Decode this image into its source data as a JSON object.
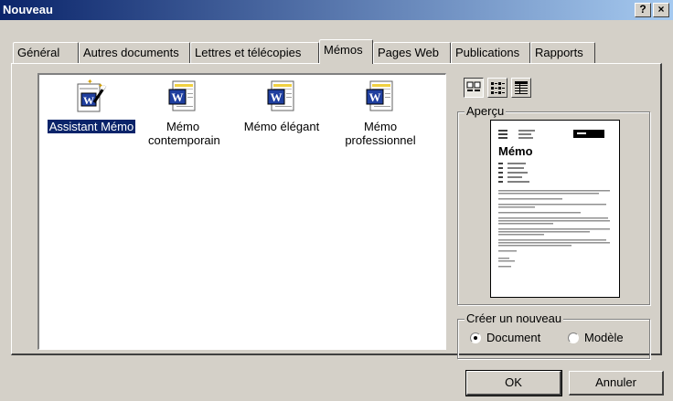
{
  "window": {
    "title": "Nouveau",
    "help_label": "?",
    "close_label": "×"
  },
  "tabs": [
    {
      "label": "Général",
      "active": false
    },
    {
      "label": "Autres documents",
      "active": false
    },
    {
      "label": "Lettres et télécopies",
      "active": false
    },
    {
      "label": "Mémos",
      "active": true
    },
    {
      "label": "Pages Web",
      "active": false
    },
    {
      "label": "Publications",
      "active": false
    },
    {
      "label": "Rapports",
      "active": false
    }
  ],
  "templates": [
    {
      "label": "Assistant Mémo",
      "icon": "word-wizard-icon",
      "selected": true
    },
    {
      "label": "Mémo contemporain",
      "icon": "word-document-icon",
      "selected": false
    },
    {
      "label": "Mémo élégant",
      "icon": "word-document-icon",
      "selected": false
    },
    {
      "label": "Mémo professionnel",
      "icon": "word-document-icon",
      "selected": false
    }
  ],
  "view_buttons": [
    {
      "name": "large-icons-view-icon",
      "pressed": true
    },
    {
      "name": "list-view-icon",
      "pressed": false
    },
    {
      "name": "details-view-icon",
      "pressed": false
    }
  ],
  "preview": {
    "label": "Aperçu",
    "page_heading": "Mémo"
  },
  "create_new": {
    "label": "Créer un nouveau",
    "options": [
      {
        "label": "Document",
        "checked": true
      },
      {
        "label": "Modèle",
        "checked": false
      }
    ]
  },
  "buttons": {
    "ok": "OK",
    "cancel": "Annuler"
  },
  "colors": {
    "titlebar_start": "#0a246a",
    "titlebar_end": "#a6caf0",
    "selection": "#0a246a",
    "face": "#d4d0c8"
  }
}
